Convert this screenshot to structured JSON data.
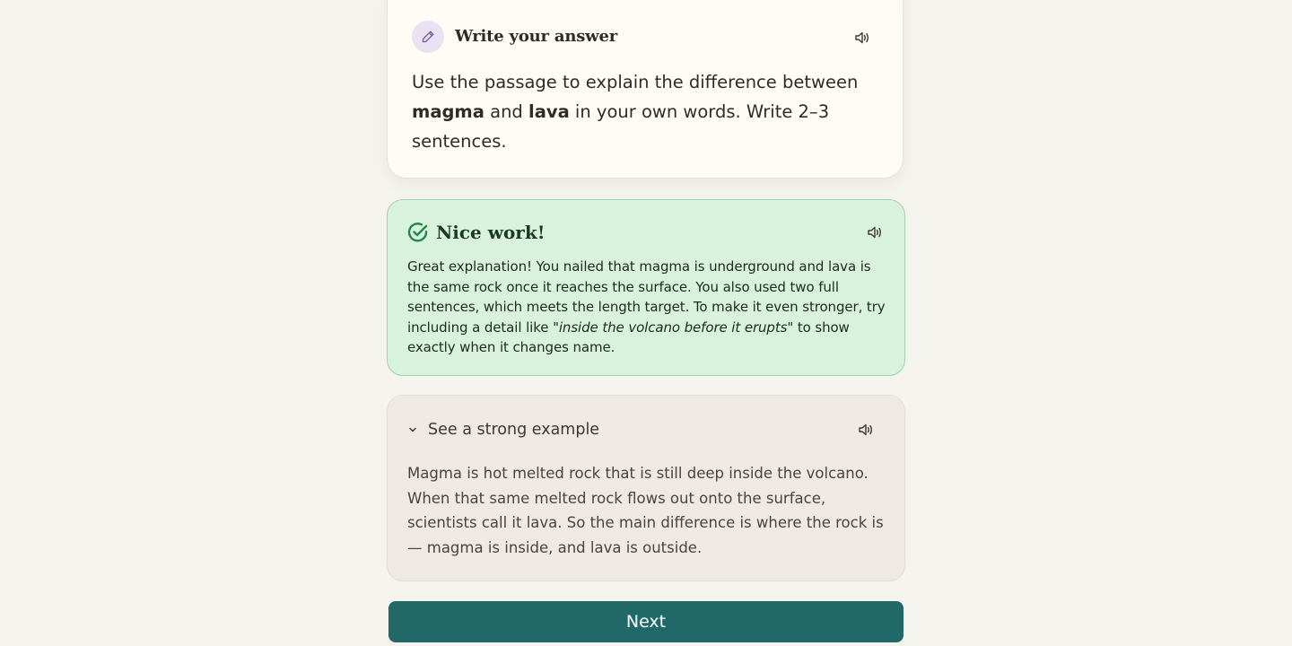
{
  "prompt": {
    "title": "Write your answer",
    "text_before": "Use the passage to explain the difference between ",
    "term1": "magma",
    "text_mid": " and ",
    "term2": "lava",
    "text_after": " in your own words. Write 2–3 sentences.",
    "icon": "pencil-icon",
    "speaker_icon": "speaker-icon"
  },
  "feedback": {
    "title": "Nice work!",
    "text_before": "Great explanation! You nailed that magma is underground and lava is the same rock once it reaches the surface. You also used two full sentences, which meets the length target. To make it even stronger, try including a detail like ",
    "quote": "\"inside the volcano before it erupts\"",
    "text_after": " to show exactly when it changes name.",
    "icon": "check-circle-icon",
    "accent_color": "#1f8a45",
    "speaker_icon": "speaker-icon"
  },
  "example": {
    "toggle_label": "See a strong example",
    "text": "Magma is hot melted rock that is still deep inside the volcano. When that same melted rock flows out onto the surface, scientists call it lava. So the main difference is where the rock is — magma is inside, and lava is outside.",
    "toggle_icon": "chevron-down-icon",
    "speaker_icon": "speaker-icon"
  },
  "next_button": {
    "label": "Next",
    "color": "#216869"
  }
}
